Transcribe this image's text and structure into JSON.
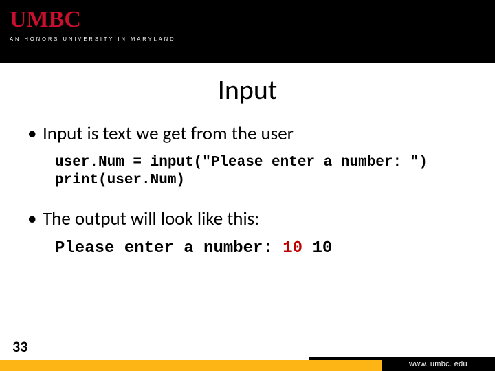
{
  "header": {
    "logo_text": "UMBC",
    "tagline": "AN HONORS UNIVERSITY IN MARYLAND"
  },
  "title": "Input",
  "content": {
    "bullet1": "Input is text we get from the user",
    "code_line1": "user.Num = input(\"Please enter a number: \")",
    "code_line2": "print(user.Num)",
    "bullet2": "The output will look like this:",
    "output_prompt": "Please enter a number: ",
    "output_user_typed": "10",
    "output_echo": "10"
  },
  "footer": {
    "page_number": "33",
    "url": "www. umbc. edu"
  }
}
